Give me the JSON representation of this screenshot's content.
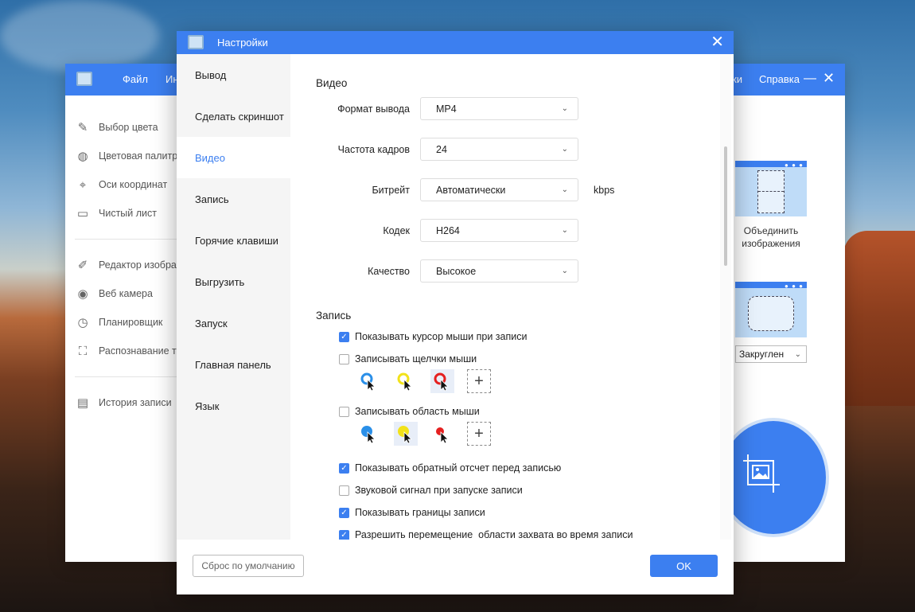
{
  "main_window": {
    "menu_file": "Файл",
    "menu_in": "Ин",
    "menu_ki": "ки",
    "menu_help": "Справка",
    "minimize": "—",
    "close": "✕",
    "tools": [
      {
        "label": "Выбор цвета",
        "icon": "pencil-icon"
      },
      {
        "label": "Цветовая палитра",
        "icon": "palette-icon"
      },
      {
        "label": "Оси координат",
        "icon": "crosshair-icon"
      },
      {
        "label": "Чистый лист",
        "icon": "whiteboard-icon"
      }
    ],
    "tools2": [
      {
        "label": "Редактор изображ",
        "icon": "image-editor-icon"
      },
      {
        "label": "Веб камера",
        "icon": "webcam-icon"
      },
      {
        "label": "Планировщик",
        "icon": "clock-icon"
      },
      {
        "label": "Распознавание те",
        "icon": "ocr-icon"
      }
    ],
    "tools3": [
      {
        "label": "История записи",
        "icon": "history-icon"
      }
    ],
    "merge_label_1": "Объединить",
    "merge_label_2": "изображения",
    "round_select": "Закруглен"
  },
  "dialog": {
    "title": "Настройки",
    "close": "✕",
    "nav": [
      {
        "label": "Вывод",
        "active": false
      },
      {
        "label": "Сделать скриншот",
        "active": false
      },
      {
        "label": "Видео",
        "active": true
      },
      {
        "label": "Запись",
        "active": false
      },
      {
        "label": "Горячие клавиши",
        "active": false
      },
      {
        "label": "Выгрузить",
        "active": false
      },
      {
        "label": "Запуск",
        "active": false
      },
      {
        "label": "Главная панель",
        "active": false
      },
      {
        "label": "Язык",
        "active": false
      }
    ],
    "video": {
      "title": "Видео",
      "format_label": "Формат вывода",
      "format_value": "MP4",
      "fps_label": "Частота кадров",
      "fps_value": "24",
      "bitrate_label": "Битрейт",
      "bitrate_value": "Автоматически",
      "bitrate_unit": "kbps",
      "codec_label": "Кодек",
      "codec_value": "H264",
      "quality_label": "Качество",
      "quality_value": "Высокое"
    },
    "record": {
      "title": "Запись",
      "show_cursor": "Показывать курсор мыши при записи",
      "show_cursor_on": true,
      "record_clicks": "Записывать щелчки мыши",
      "record_clicks_on": false,
      "record_area": "Записывать область мыши",
      "record_area_on": false,
      "countdown": "Показывать обратный отсчет перед записью",
      "countdown_on": true,
      "beep": "Звуковой сигнал при запуске записи",
      "beep_on": false,
      "borders": "Показывать границы записи",
      "borders_on": true,
      "move_area": "Разрешить перемещение  области захвата во время записи",
      "move_area_on": true,
      "click_colors": [
        "#2a8fe8",
        "#f2e21a",
        "#e52020"
      ],
      "area_colors": [
        "#2a8fe8",
        "#f2e21a",
        "#e52020"
      ],
      "plus": "+"
    },
    "reset_button": "Сброс по умолчанию",
    "ok_button": "OK"
  }
}
